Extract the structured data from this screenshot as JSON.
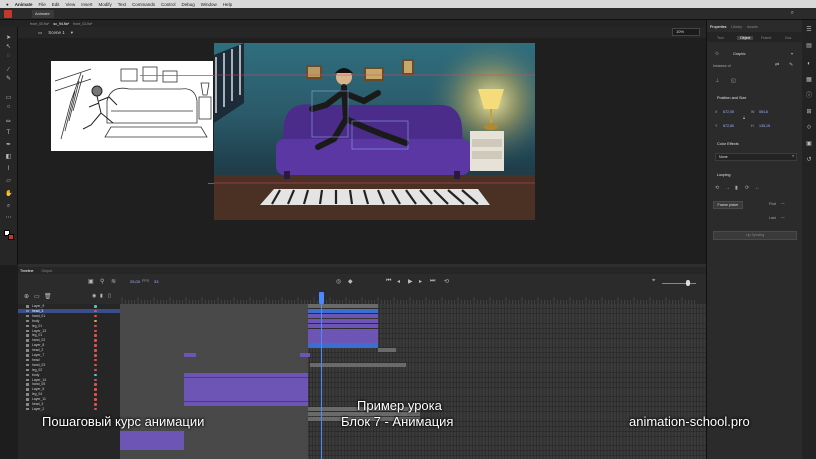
{
  "menubar": {
    "apple": "",
    "items": [
      "Animate",
      "File",
      "Edit",
      "View",
      "Insert",
      "Modify",
      "Text",
      "Commands",
      "Control",
      "Debug",
      "Window",
      "Help"
    ]
  },
  "doctabs": [
    "front_00.fla*",
    "sc_94.fla*",
    "front_02.fla*"
  ],
  "scene": {
    "label": "Scene 1"
  },
  "zoom": "10%",
  "properties": {
    "tabs": [
      "Tool",
      "Object",
      "Frame",
      "Doc"
    ],
    "panel_tabs": [
      "Properties",
      "Library",
      "Assets"
    ],
    "symbol_type": "Graphic",
    "instance_of": "Instance of",
    "position_size_label": "Position and Size",
    "x_label": "X",
    "x_value": "672,05",
    "y_label": "Y",
    "y_value": "672,80",
    "w_label": "W",
    "w_value": "554,6",
    "h_label": "H",
    "h_value": "135,15",
    "color_effects_label": "Color Effects",
    "color_effect_value": "None",
    "looping_label": "Looping",
    "frame_picker_label": "Frame picker",
    "first_label": "First",
    "last_label": "Last",
    "lip_syncing_label": "Lip Syncing"
  },
  "timeline": {
    "tabs": [
      "Timeline",
      "Output"
    ],
    "fps": "25,00",
    "fps_unit": "FPS",
    "current_frame": "33",
    "layers": [
      "Layer_9",
      "head_3",
      "hand_01",
      "body",
      "leg_01",
      "Layer_13",
      "leg_01",
      "hand_02",
      "Layer_8",
      "head_2",
      "Layer_7",
      "head",
      "hand_03",
      "leg_02",
      "body",
      "Layer_14",
      "hand_05",
      "Layer_5",
      "leg_04",
      "Layer_11",
      "head_3",
      "Layer_2"
    ]
  },
  "captions": {
    "left": "Пошаговый курс анимации",
    "center_line1": "Пример урока",
    "center_line2": "Блок 7 - Анимация",
    "right": "animation-school.pro"
  }
}
